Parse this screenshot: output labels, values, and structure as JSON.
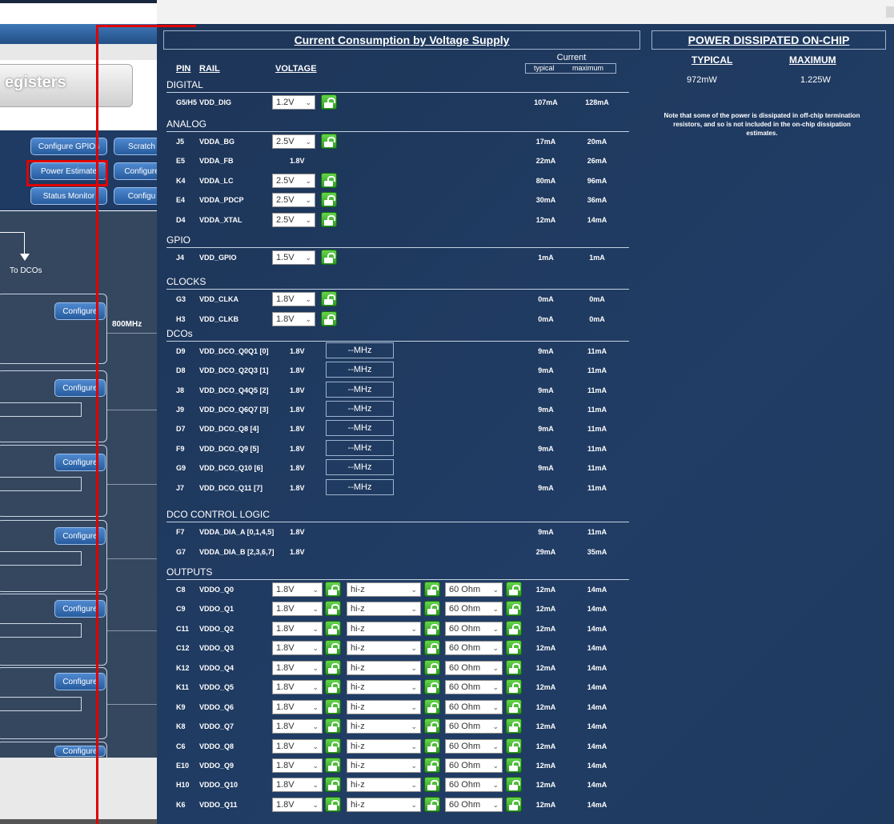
{
  "background_app": {
    "registers_tab": "egisters",
    "buttons": {
      "configure_gpio": "Configure GPIOs",
      "scratch": "Scratch",
      "power_estimate": "Power Estimate",
      "configure_2": "Configure",
      "status_monitor": "Status Monitor",
      "configure_3": "Configu"
    },
    "to_dcos": "To DCOs",
    "freq_label": "800MHz",
    "configure_label": "Configure"
  },
  "current_consumption": {
    "title": "Current Consumption by Voltage Supply",
    "col_pin": "PIN",
    "col_rail": "RAIL",
    "col_voltage": "VOLTAGE",
    "col_current": "Current",
    "col_typical": "typical",
    "col_maximum": "maximum"
  },
  "power_dissipated": {
    "title": "POWER DISSIPATED ON-CHIP",
    "typical_label": "TYPICAL",
    "maximum_label": "MAXIMUM",
    "typical_value": "972mW",
    "maximum_value": "1.225W",
    "note": "Note that some of the power is dissipated in off-chip termination resistors, and so is not included in the on-chip dissipation estimates."
  },
  "groups": [
    {
      "name": "DIGITAL",
      "rows": [
        {
          "pin": "G5/H5",
          "rail": "VDD_DIG",
          "voltage": "1.2V",
          "kind": "select",
          "typical": "107mA",
          "maximum": "128mA"
        }
      ]
    },
    {
      "name": "ANALOG",
      "rows": [
        {
          "pin": "J5",
          "rail": "VDDA_BG",
          "voltage": "2.5V",
          "kind": "select",
          "typical": "17mA",
          "maximum": "20mA"
        },
        {
          "pin": "E5",
          "rail": "VDDA_FB",
          "voltage": "1.8V",
          "kind": "text",
          "typical": "22mA",
          "maximum": "26mA"
        },
        {
          "pin": "K4",
          "rail": "VDDA_LC",
          "voltage": "2.5V",
          "kind": "select",
          "typical": "80mA",
          "maximum": "96mA"
        },
        {
          "pin": "E4",
          "rail": "VDDA_PDCP",
          "voltage": "2.5V",
          "kind": "select",
          "typical": "30mA",
          "maximum": "36mA"
        },
        {
          "pin": "D4",
          "rail": "VDDA_XTAL",
          "voltage": "2.5V",
          "kind": "select",
          "typical": "12mA",
          "maximum": "14mA"
        }
      ]
    },
    {
      "name": "GPIO",
      "rows": [
        {
          "pin": "J4",
          "rail": "VDD_GPIO",
          "voltage": "1.5V",
          "kind": "select",
          "typical": "1mA",
          "maximum": "1mA"
        }
      ]
    },
    {
      "name": "CLOCKS",
      "rows": [
        {
          "pin": "G3",
          "rail": "VDD_CLKA",
          "voltage": "1.8V",
          "kind": "select",
          "typical": "0mA",
          "maximum": "0mA"
        },
        {
          "pin": "H3",
          "rail": "VDD_CLKB",
          "voltage": "1.8V",
          "kind": "select",
          "typical": "0mA",
          "maximum": "0mA"
        }
      ]
    },
    {
      "name": "DCOs",
      "rows": [
        {
          "pin": "D9",
          "rail": "VDD_DCO_Q0Q1 [0]",
          "voltage": "1.8V",
          "kind": "mhz",
          "mhz": "--MHz",
          "typical": "9mA",
          "maximum": "11mA"
        },
        {
          "pin": "D8",
          "rail": "VDD_DCO_Q2Q3 [1]",
          "voltage": "1.8V",
          "kind": "mhz",
          "mhz": "--MHz",
          "typical": "9mA",
          "maximum": "11mA"
        },
        {
          "pin": "J8",
          "rail": "VDD_DCO_Q4Q5 [2]",
          "voltage": "1.8V",
          "kind": "mhz",
          "mhz": "--MHz",
          "typical": "9mA",
          "maximum": "11mA"
        },
        {
          "pin": "J9",
          "rail": "VDD_DCO_Q6Q7 [3]",
          "voltage": "1.8V",
          "kind": "mhz",
          "mhz": "--MHz",
          "typical": "9mA",
          "maximum": "11mA"
        },
        {
          "pin": "D7",
          "rail": "VDD_DCO_Q8 [4]",
          "voltage": "1.8V",
          "kind": "mhz",
          "mhz": "--MHz",
          "typical": "9mA",
          "maximum": "11mA"
        },
        {
          "pin": "F9",
          "rail": "VDD_DCO_Q9 [5]",
          "voltage": "1.8V",
          "kind": "mhz",
          "mhz": "--MHz",
          "typical": "9mA",
          "maximum": "11mA"
        },
        {
          "pin": "G9",
          "rail": "VDD_DCO_Q10 [6]",
          "voltage": "1.8V",
          "kind": "mhz",
          "mhz": "--MHz",
          "typical": "9mA",
          "maximum": "11mA"
        },
        {
          "pin": "J7",
          "rail": "VDD_DCO_Q11 [7]",
          "voltage": "1.8V",
          "kind": "mhz",
          "mhz": "--MHz",
          "typical": "9mA",
          "maximum": "11mA"
        }
      ]
    },
    {
      "name": "DCO CONTROL LOGIC",
      "rows": [
        {
          "pin": "F7",
          "rail": "VDDA_DIA_A [0,1,4,5]",
          "voltage": "1.8V",
          "kind": "text",
          "typical": "9mA",
          "maximum": "11mA"
        },
        {
          "pin": "G7",
          "rail": "VDDA_DIA_B [2,3,6,7]",
          "voltage": "1.8V",
          "kind": "text",
          "typical": "29mA",
          "maximum": "35mA"
        }
      ]
    },
    {
      "name": "OUTPUTS",
      "rows": [
        {
          "pin": "C8",
          "rail": "VDDO_Q0",
          "voltage": "1.8V",
          "kind": "output",
          "mode": "hi-z",
          "impedance": "60 Ohm",
          "typical": "12mA",
          "maximum": "14mA"
        },
        {
          "pin": "C9",
          "rail": "VDDO_Q1",
          "voltage": "1.8V",
          "kind": "output",
          "mode": "hi-z",
          "impedance": "60 Ohm",
          "typical": "12mA",
          "maximum": "14mA"
        },
        {
          "pin": "C11",
          "rail": "VDDO_Q2",
          "voltage": "1.8V",
          "kind": "output",
          "mode": "hi-z",
          "impedance": "60 Ohm",
          "typical": "12mA",
          "maximum": "14mA"
        },
        {
          "pin": "C12",
          "rail": "VDDO_Q3",
          "voltage": "1.8V",
          "kind": "output",
          "mode": "hi-z",
          "impedance": "60 Ohm",
          "typical": "12mA",
          "maximum": "14mA"
        },
        {
          "pin": "K12",
          "rail": "VDDO_Q4",
          "voltage": "1.8V",
          "kind": "output",
          "mode": "hi-z",
          "impedance": "60 Ohm",
          "typical": "12mA",
          "maximum": "14mA"
        },
        {
          "pin": "K11",
          "rail": "VDDO_Q5",
          "voltage": "1.8V",
          "kind": "output",
          "mode": "hi-z",
          "impedance": "60 Ohm",
          "typical": "12mA",
          "maximum": "14mA"
        },
        {
          "pin": "K9",
          "rail": "VDDO_Q6",
          "voltage": "1.8V",
          "kind": "output",
          "mode": "hi-z",
          "impedance": "60 Ohm",
          "typical": "12mA",
          "maximum": "14mA"
        },
        {
          "pin": "K8",
          "rail": "VDDO_Q7",
          "voltage": "1.8V",
          "kind": "output",
          "mode": "hi-z",
          "impedance": "60 Ohm",
          "typical": "12mA",
          "maximum": "14mA"
        },
        {
          "pin": "C6",
          "rail": "VDDO_Q8",
          "voltage": "1.8V",
          "kind": "output",
          "mode": "hi-z",
          "impedance": "60 Ohm",
          "typical": "12mA",
          "maximum": "14mA"
        },
        {
          "pin": "E10",
          "rail": "VDDO_Q9",
          "voltage": "1.8V",
          "kind": "output",
          "mode": "hi-z",
          "impedance": "60 Ohm",
          "typical": "12mA",
          "maximum": "14mA"
        },
        {
          "pin": "H10",
          "rail": "VDDO_Q10",
          "voltage": "1.8V",
          "kind": "output",
          "mode": "hi-z",
          "impedance": "60 Ohm",
          "typical": "12mA",
          "maximum": "14mA"
        },
        {
          "pin": "K6",
          "rail": "VDDO_Q11",
          "voltage": "1.8V",
          "kind": "output",
          "mode": "hi-z",
          "impedance": "60 Ohm",
          "typical": "12mA",
          "maximum": "14mA"
        }
      ]
    }
  ]
}
